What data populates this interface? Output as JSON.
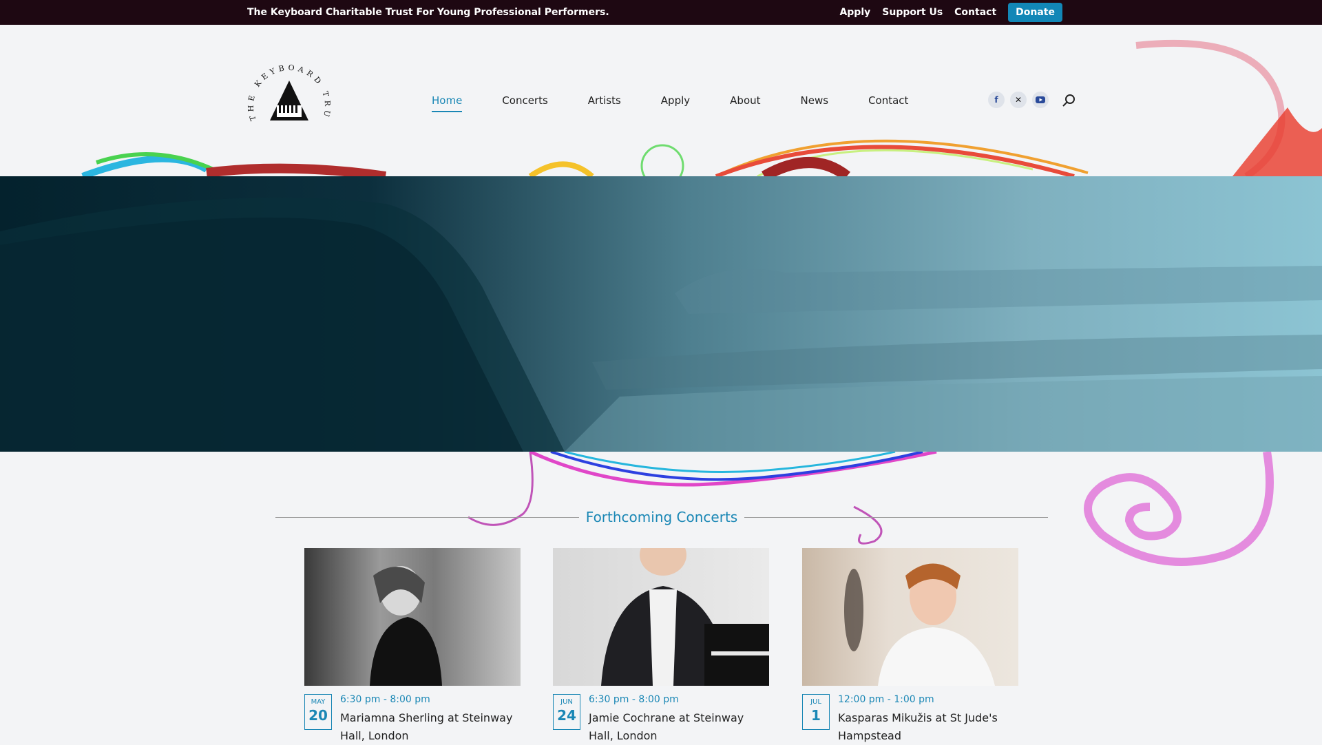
{
  "topbar": {
    "tagline": "The Keyboard Charitable Trust For Young Professional Performers.",
    "links": [
      "Apply",
      "Support Us",
      "Contact"
    ],
    "donate": "Donate"
  },
  "logo": {
    "arc_text": "THE KEYBOARD TRUST"
  },
  "nav": [
    {
      "label": "Home",
      "active": true
    },
    {
      "label": "Concerts"
    },
    {
      "label": "Artists"
    },
    {
      "label": "Apply"
    },
    {
      "label": "About"
    },
    {
      "label": "News"
    },
    {
      "label": "Contact"
    }
  ],
  "social": [
    "facebook-icon",
    "x-icon",
    "youtube-icon"
  ],
  "section": {
    "title": "Forthcoming Concerts"
  },
  "concerts": [
    {
      "month": "MAY",
      "day": "20",
      "time": "6:30 pm - 8:00 pm",
      "title": "Mariamna Sherling at Steinway Hall, London"
    },
    {
      "month": "JUN",
      "day": "24",
      "time": "6:30 pm - 8:00 pm",
      "title": "Jamie Cochrane at Steinway Hall, London"
    },
    {
      "month": "JUL",
      "day": "1",
      "time": "12:00 pm - 1:00 pm",
      "title": "Kasparas Mikužis at St Jude's Hampstead"
    }
  ],
  "colors": {
    "accent": "#1a87b5",
    "topbar": "#1e0812",
    "donate": "#1287b7"
  }
}
